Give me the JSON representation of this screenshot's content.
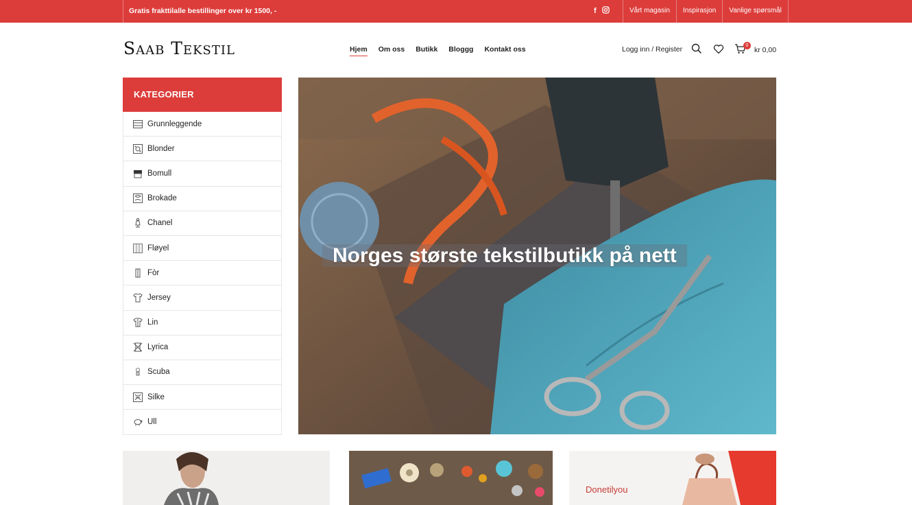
{
  "topbar": {
    "promo": "Gratis frakttilalle bestillinger over kr 1500, -",
    "social": [
      "facebook-icon",
      "instagram-icon"
    ],
    "links": [
      "Vårt magasin",
      "Inspirasjon",
      "Vanlige spørsmål"
    ],
    "color": "#dc3d3b"
  },
  "header": {
    "logo": "Saab Tekstil",
    "nav": [
      "Hjem",
      "Om oss",
      "Butikk",
      "Bloggg",
      "Kontakt oss"
    ],
    "login": "Logg inn / Register",
    "cart_count": "0",
    "cart_total": "kr 0,00"
  },
  "sidebar": {
    "title": "KATEGORIER",
    "items": [
      "Grunnleggende",
      "Blonder",
      "Bomull",
      "Brokade",
      "Chanel",
      "Fløyel",
      "Fòr",
      "Jersey",
      "Lin",
      "Lyrica",
      "Scuba",
      "Silke",
      "Ull"
    ]
  },
  "hero": {
    "title": "Norges største tekstilbutikk på nett"
  },
  "tiles": {
    "brand": "Donetilyou"
  }
}
